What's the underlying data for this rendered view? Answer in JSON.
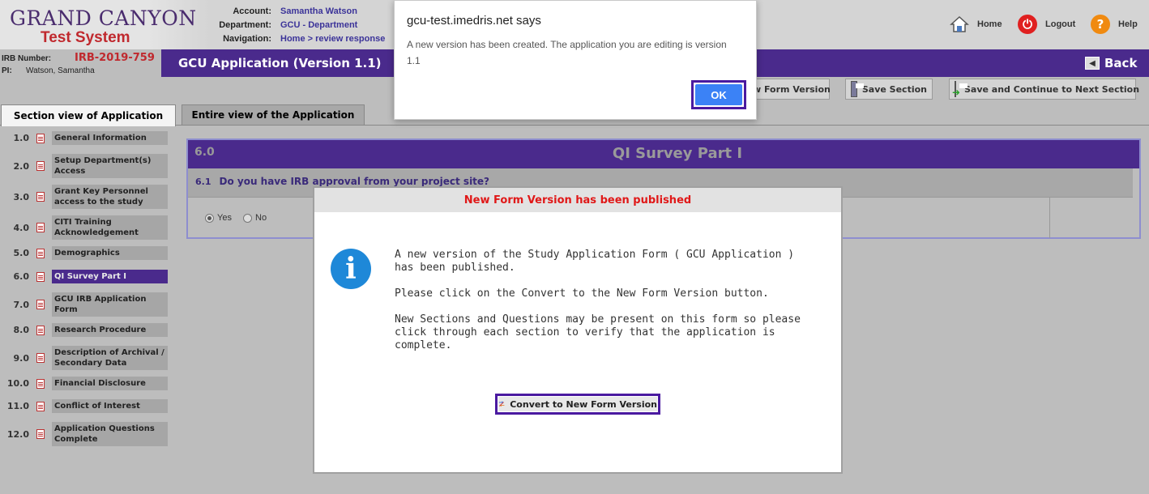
{
  "header": {
    "logo_line1": "GRAND CANYON",
    "logo_line2": "Test System",
    "account_label": "Account:",
    "account_value": "Samantha Watson",
    "department_label": "Department:",
    "department_value": "GCU - Department",
    "navigation_label": "Navigation:",
    "navigation_value": "Home > review response",
    "links": {
      "home": "Home",
      "logout": "Logout",
      "help": "Help"
    },
    "irb_label": "IRB Number:",
    "irb_value": "IRB-2019-759",
    "pi_label": "PI:",
    "pi_value": "Watson, Samantha"
  },
  "appbar": {
    "title": "GCU Application (Version 1.1)",
    "back_label": "Back"
  },
  "toolbar": {
    "convert_label": "w Form Version",
    "save_section_label": "Save Section",
    "save_continue_label": "Save and Continue to Next Section"
  },
  "tabs": {
    "section_view": "Section view of Application",
    "entire_view": "Entire view of the Application"
  },
  "sidebar": {
    "items": [
      {
        "num": "1.0",
        "label": "General Information"
      },
      {
        "num": "2.0",
        "label": "Setup Department(s) Access"
      },
      {
        "num": "3.0",
        "label": "Grant Key Personnel access to the study"
      },
      {
        "num": "4.0",
        "label": "CITI Training Acknowledgement"
      },
      {
        "num": "5.0",
        "label": "Demographics"
      },
      {
        "num": "6.0",
        "label": "QI Survey Part I"
      },
      {
        "num": "7.0",
        "label": "GCU IRB Application Form"
      },
      {
        "num": "8.0",
        "label": "Research Procedure"
      },
      {
        "num": "9.0",
        "label": "Description of Archival / Secondary Data"
      },
      {
        "num": "10.0",
        "label": "Financial Disclosure"
      },
      {
        "num": "11.0",
        "label": "Conflict of Interest"
      },
      {
        "num": "12.0",
        "label": "Application Questions Complete"
      }
    ]
  },
  "section": {
    "number": "6.0",
    "title": "QI Survey Part I",
    "question_number": "6.1",
    "question_text": "Do you have IRB approval from your project site?",
    "option_yes": "Yes",
    "option_no": "No",
    "selected": "Yes"
  },
  "browser_dialog": {
    "title": "gcu-test.imedris.net says",
    "message": "A new version has been created. The application you are editing is version 1.1",
    "ok_label": "OK"
  },
  "modal": {
    "title": "New Form Version has been published",
    "paragraph1": "A new version of the Study Application Form ( GCU Application ) has been published.",
    "paragraph2": "Please click on the Convert to the New Form Version button.",
    "paragraph3": "New Sections and Questions may be present on this form so please click through each section to verify that the application is complete.",
    "convert_button": "Convert to New Form Version"
  },
  "colors": {
    "brand_purple": "#4a2a8c",
    "brand_red": "#c0292e",
    "info_blue": "#1e88d8",
    "ok_blue": "#3b82f6",
    "modal_title_red": "#e01818"
  }
}
